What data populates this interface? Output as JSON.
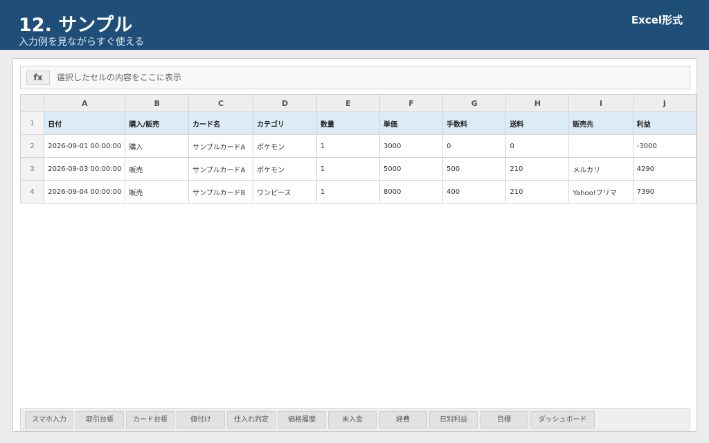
{
  "header": {
    "title": "12. サンプル",
    "subtitle": "入力例を見ながらすぐ使える",
    "format_label": "Excel形式"
  },
  "formula_bar": {
    "fx_label": "fx",
    "text": "選択したセルの内容をここに表示"
  },
  "sheet": {
    "columns": [
      "A",
      "B",
      "C",
      "D",
      "E",
      "F",
      "G",
      "H",
      "I",
      "J"
    ],
    "row_numbers": [
      "1",
      "2",
      "3",
      "4"
    ],
    "header_row": [
      "日付",
      "購入/販売",
      "カード名",
      "カテゴリ",
      "数量",
      "単価",
      "手数料",
      "送料",
      "販売先",
      "利益"
    ],
    "rows": [
      [
        "2026-09-01 00:00:00",
        "購入",
        "サンプルカードA",
        "ポケモン",
        "1",
        "3000",
        "0",
        "0",
        "",
        "-3000"
      ],
      [
        "2026-09-03 00:00:00",
        "販売",
        "サンプルカードA",
        "ポケモン",
        "1",
        "5000",
        "500",
        "210",
        "メルカリ",
        "4290"
      ],
      [
        "2026-09-04 00:00:00",
        "販売",
        "サンプルカードB",
        "ワンピース",
        "1",
        "8000",
        "400",
        "210",
        "Yahoo!フリマ",
        "7390"
      ]
    ]
  },
  "tabs": [
    "スマホ入力",
    "取引台帳",
    "カード台帳",
    "値付け",
    "仕入れ判定",
    "価格履歴",
    "未入金",
    "経費",
    "日別利益",
    "目標",
    "ダッシュボード"
  ],
  "colors": {
    "header_bg": "#1f4e79",
    "header_row_bg": "#ddebf7"
  }
}
